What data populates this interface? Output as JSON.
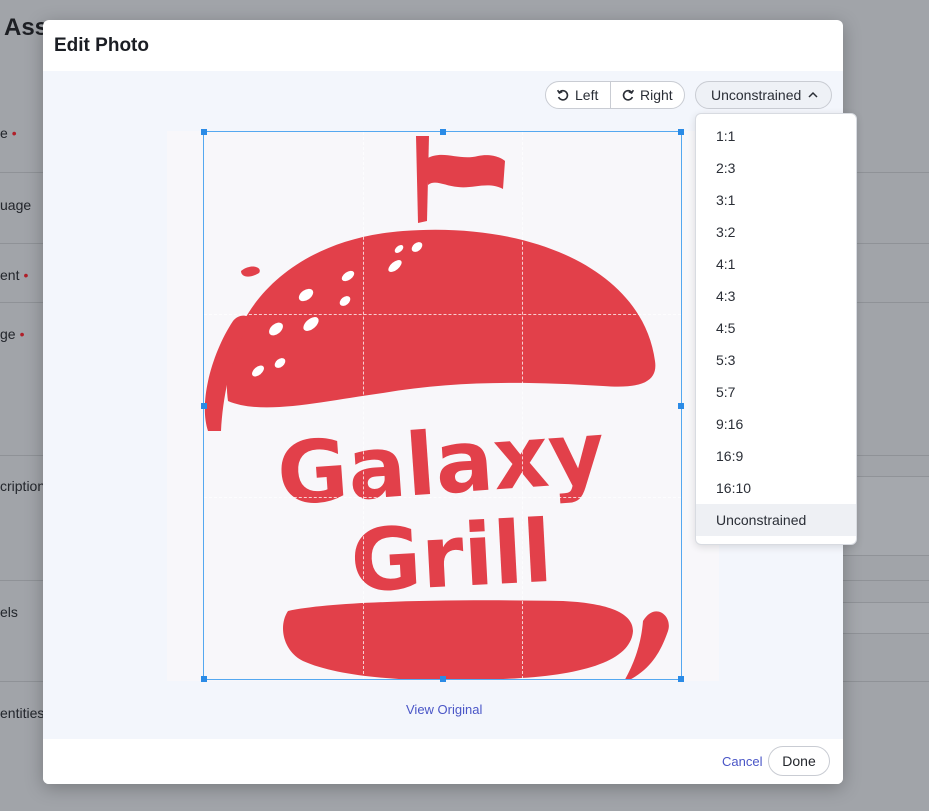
{
  "background": {
    "title": "Ass",
    "labels": [
      {
        "text": "e",
        "required": true
      },
      {
        "text": "uage",
        "required": false
      },
      {
        "text": "ent",
        "required": true
      },
      {
        "text": "ge",
        "required": true
      },
      {
        "text": "cription",
        "required": false
      },
      {
        "text": "els",
        "required": false
      },
      {
        "text": "entities",
        "required": false
      }
    ]
  },
  "modal": {
    "title": "Edit Photo",
    "rotate_left_label": "Left",
    "rotate_right_label": "Right",
    "aspect_selected": "Unconstrained",
    "aspect_options": [
      "1:1",
      "2:3",
      "3:1",
      "3:2",
      "4:1",
      "4:3",
      "4:5",
      "5:3",
      "5:7",
      "9:16",
      "16:9",
      "16:10",
      "Unconstrained"
    ],
    "view_original": "View Original",
    "cancel_label": "Cancel",
    "done_label": "Done"
  },
  "image": {
    "logo_text_line1": "Galaxy",
    "logo_text_line2": "Grill",
    "logo_color": "#e2404a"
  },
  "colors": {
    "accent_link": "#4a56c7",
    "crop_border": "#55a8f0",
    "required": "#b0202a"
  }
}
